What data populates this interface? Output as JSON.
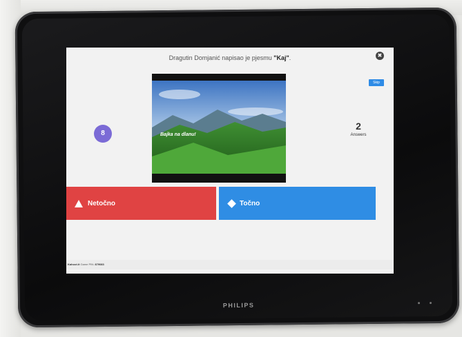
{
  "device": {
    "brand": "PHILIPS"
  },
  "quiz": {
    "question_prefix": "Dragutin Domjanić napisao je pjesmu ",
    "question_highlight": "\"Kaj\"",
    "question_suffix": ".",
    "skip_label": "Skip",
    "timer_value": "8",
    "answers_count": "2",
    "answers_label": "Answers",
    "media_caption": "Bajka na dlanu!",
    "options": [
      {
        "label": "Netočno",
        "shape": "triangle",
        "color": "#e04343"
      },
      {
        "label": "Točno",
        "shape": "diamond",
        "color": "#2f8de4"
      }
    ],
    "footer_prefix": "Kahoot.it",
    "footer_pin_label": "Game PIN:",
    "footer_pin": "879083"
  },
  "colors": {
    "accent_purple": "#7b6bd6",
    "skip_blue": "#2e8be6"
  }
}
